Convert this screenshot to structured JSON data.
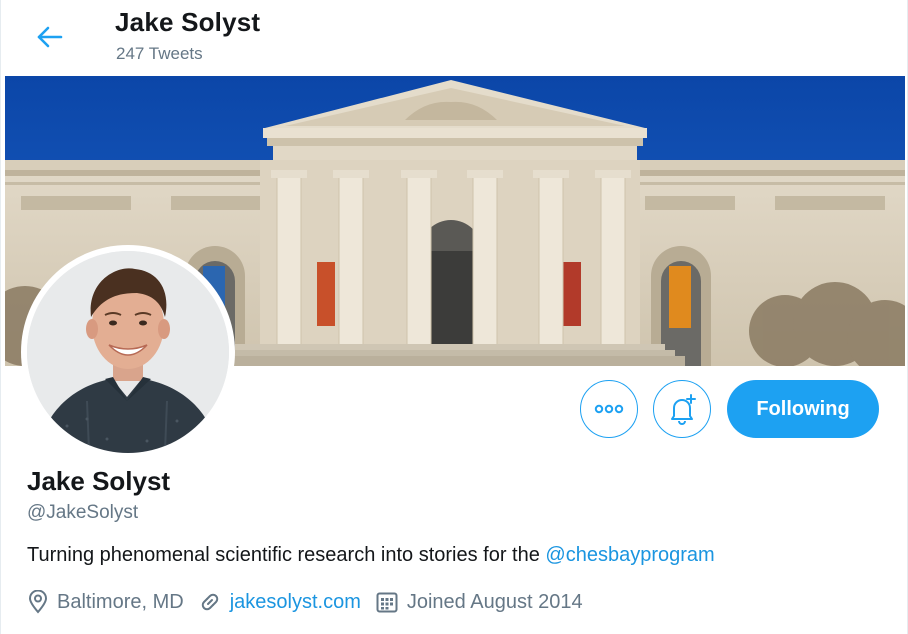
{
  "header": {
    "title": "Jake Solyst",
    "tweet_count": "247 Tweets"
  },
  "actions": {
    "more_label": "•••",
    "follow_label": "Following"
  },
  "profile": {
    "name": "Jake Solyst",
    "handle": "@JakeSolyst",
    "bio_text": "Turning phenomenal scientific research into stories for the ",
    "bio_mention": "@chesbayprogram",
    "location": "Baltimore, MD",
    "website": "jakesolyst.com",
    "joined": "Joined August 2014"
  },
  "icons": {
    "back": "arrow-left-icon",
    "more": "more-horizontal-icon",
    "notify": "bell-plus-icon",
    "location": "location-pin-icon",
    "link": "link-icon",
    "calendar": "calendar-icon"
  },
  "colors": {
    "accent": "#1da1f2",
    "link": "#1b95e0",
    "secondary_text": "#657786",
    "primary_text": "#14171a"
  }
}
